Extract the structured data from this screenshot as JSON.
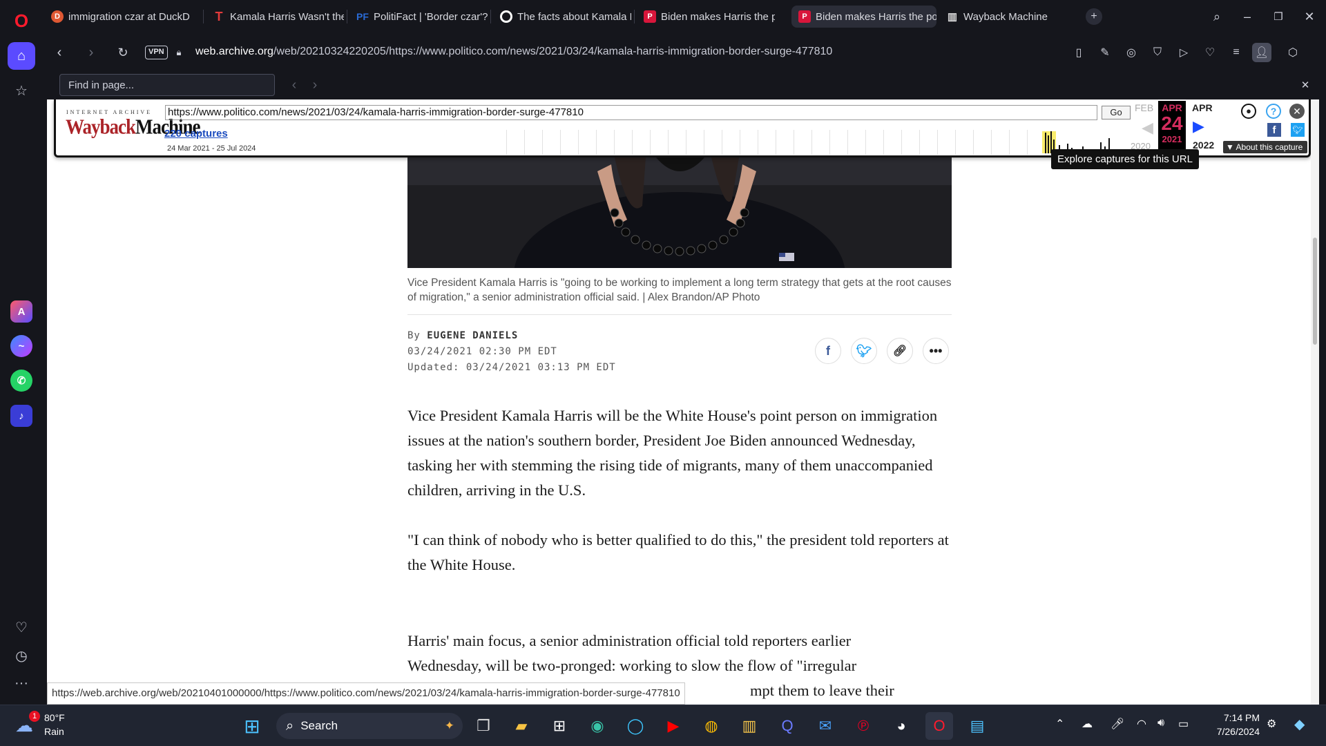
{
  "browser": {
    "tabs": [
      {
        "title": "immigration czar at DuckD",
        "icon": "duckduckgo-icon",
        "color": "#de5833"
      },
      {
        "title": "Kamala Harris Wasn't the",
        "icon": "t-logo-icon",
        "color": "#e23b3b"
      },
      {
        "title": "PolitiFact | 'Border czar'? K",
        "icon": "politifact-icon",
        "color": "#2a6bd6"
      },
      {
        "title": "The facts about Kamala H",
        "icon": "circle-logo-icon",
        "color": "#ffffff"
      },
      {
        "title": "Biden makes Harris the po",
        "icon": "politico-icon",
        "color": "#d8163b"
      },
      {
        "title": "Biden makes Harris the po",
        "icon": "politico-icon",
        "color": "#d8163b"
      },
      {
        "title": "Wayback Machine",
        "icon": "archive-icon",
        "color": "#dddddd"
      }
    ],
    "url_host": "web.archive.org",
    "url_rest": "/web/20210324220205/https://www.politico.com/news/2021/03/24/kamala-harris-immigration-border-surge-477810",
    "vpn_label": "VPN",
    "find_placeholder": "Find in page...",
    "status_url": "https://web.archive.org/web/20210401000000/https://www.politico.com/news/2021/03/24/kamala-harris-immigration-border-surge-477810"
  },
  "wayback": {
    "logo_top": "INTERNET ARCHIVE",
    "logo_a": "Wayback",
    "logo_b": "Machine",
    "url": "https://www.politico.com/news/2021/03/24/kamala-harris-immigration-border-surge-477810",
    "go_label": "Go",
    "captures": "220 captures",
    "range": "24 Mar 2021 - 25 Jul 2024",
    "prev_month": "FEB",
    "cur_month": "APR",
    "cur_day": "24",
    "cur_year": "2021",
    "next_month": "APR",
    "prev_year": "2020",
    "next_year": "2022",
    "about": "▼ About this capture",
    "tooltip": "Explore captures for this URL"
  },
  "article": {
    "caption": "Vice President Kamala Harris is \"going to be working to implement a long term strategy that gets at the root causes of migration,\" a senior administration official said. | Alex Brandon/AP Photo",
    "by_prefix": "By",
    "author": "EUGENE DANIELS",
    "date": "03/24/2021 02:30 PM EDT",
    "updated": "Updated: 03/24/2021 03:13 PM EDT",
    "p1": "Vice President Kamala Harris will be the White House's point person on immigration issues at the nation's southern border, President Joe Biden announced Wednesday, tasking her with stemming the rising tide of migrants, many of them unaccompanied children, arriving in the U.S.",
    "p2": "\"I can think of nobody who is better qualified to do this,\" the president told reporters at the White House.",
    "p3": "Harris' main focus, a senior administration official told reporters earlier Wednesday, will be two-pronged: working to slow the flow of \"irregular",
    "p3_tail": "mpt them to leave their"
  },
  "taskbar": {
    "weather_temp": "80°F",
    "weather_desc": "Rain",
    "weather_badge": "1",
    "search_label": "Search",
    "time": "7:14 PM",
    "date": "7/26/2024"
  }
}
